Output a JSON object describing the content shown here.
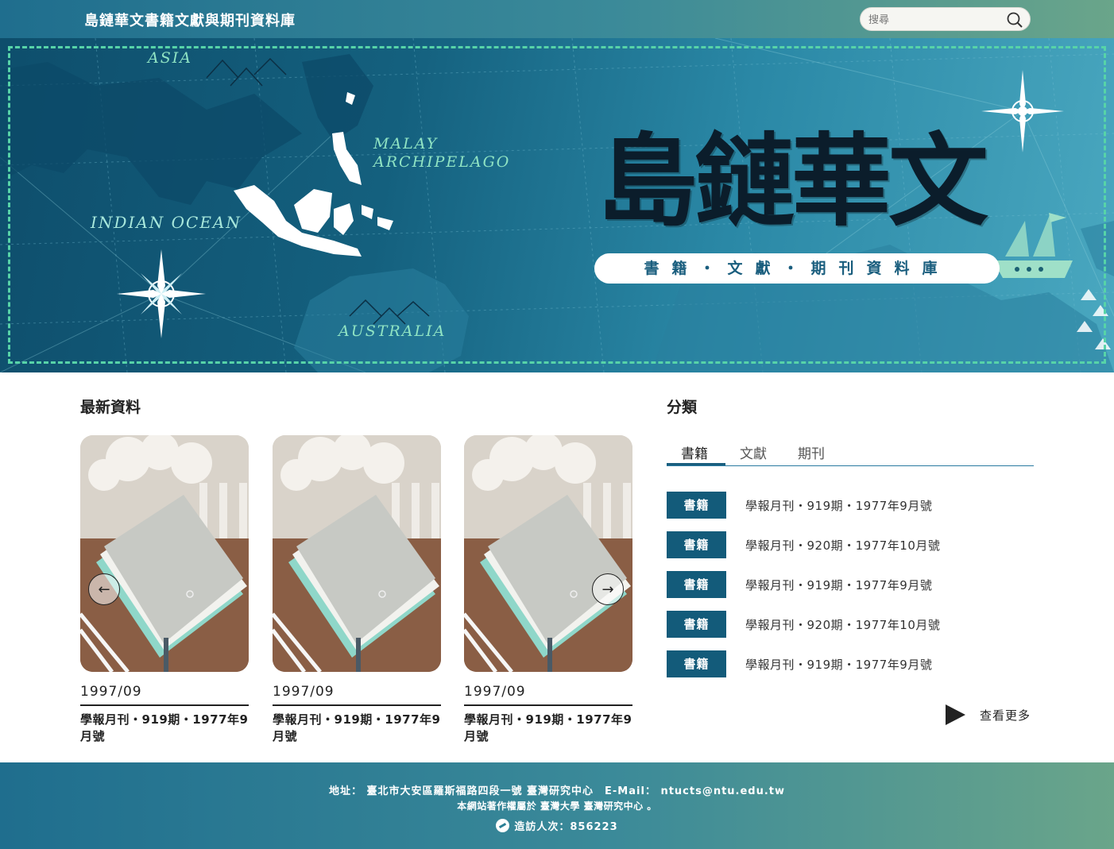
{
  "header": {
    "site_title": "島鏈華文書籍文獻與期刊資料庫",
    "search_placeholder": "搜尋"
  },
  "banner": {
    "map_labels": {
      "asia": "ASIA",
      "malay_line1": "MALAY",
      "malay_line2": "ARCHIPELAGO",
      "indian_ocean": "INDIAN OCEAN",
      "australia": "AUSTRALIA"
    },
    "logo_text": "島鏈華文",
    "subtitle": "書籍・文獻・期刊資料庫"
  },
  "latest": {
    "title": "最新資料",
    "cards": [
      {
        "date": "1997/09",
        "title": "學報月刊・919期・1977年9月號"
      },
      {
        "date": "1997/09",
        "title": "學報月刊・919期・1977年9月號"
      },
      {
        "date": "1997/09",
        "title": "學報月刊・919期・1977年9月號"
      }
    ]
  },
  "categories": {
    "title": "分類",
    "tabs": [
      "書籍",
      "文獻",
      "期刊"
    ],
    "active_tab": "書籍",
    "items": [
      {
        "badge": "書籍",
        "text": "學報月刊・919期・1977年9月號"
      },
      {
        "badge": "書籍",
        "text": "學報月刊・920期・1977年10月號"
      },
      {
        "badge": "書籍",
        "text": "學報月刊・919期・1977年9月號"
      },
      {
        "badge": "書籍",
        "text": "學報月刊・920期・1977年10月號"
      },
      {
        "badge": "書籍",
        "text": "學報月刊・919期・1977年9月號"
      }
    ],
    "more_label": "查看更多"
  },
  "footer": {
    "address_line": "地址： 臺北市大安區羅斯福路四段一號 臺灣研究中心　E-Mail： ntucts@ntu.edu.tw",
    "copyright_line": "本網站著作權屬於 臺灣大學 臺灣研究中心 。",
    "visitor_line": "造訪人次：856223"
  },
  "colors": {
    "header_gradient_start": "#1f6e8e",
    "header_gradient_end": "#6aa58a",
    "badge": "#135b7a",
    "frame_dash": "#57d3a8"
  }
}
